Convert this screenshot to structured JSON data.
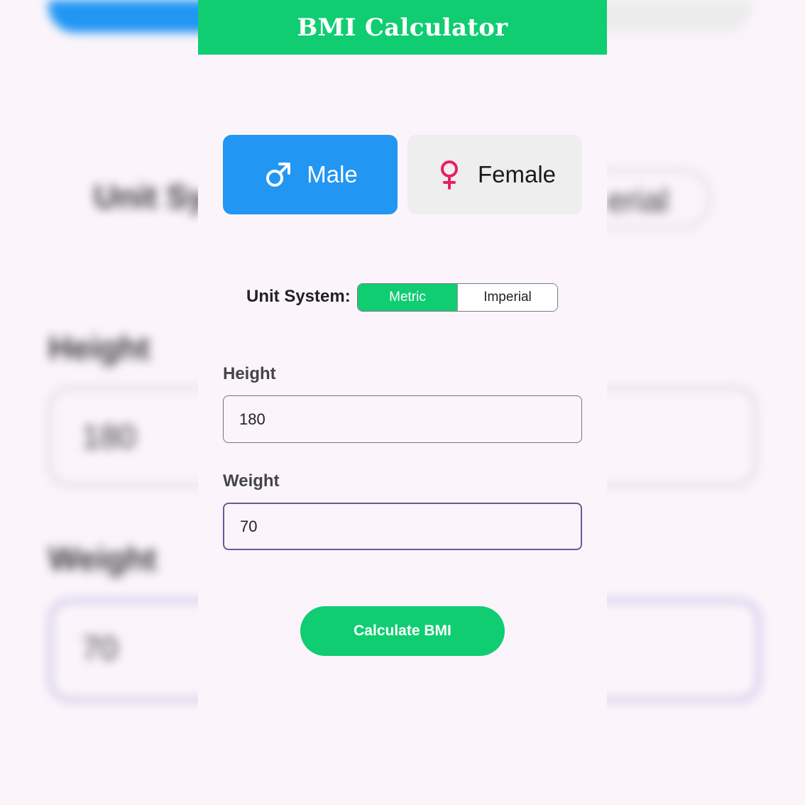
{
  "app_bar": {
    "title": "BMI Calculator"
  },
  "gender": {
    "male": {
      "label": "Male",
      "icon": "male-symbol-icon",
      "selected": true
    },
    "female": {
      "label": "Female",
      "icon": "female-symbol-icon",
      "selected": false
    }
  },
  "unit_system": {
    "label": "Unit System:",
    "options": [
      "Metric",
      "Imperial"
    ],
    "selected": "Metric"
  },
  "height": {
    "label": "Height",
    "value": "180"
  },
  "weight": {
    "label": "Weight",
    "value": "70"
  },
  "actions": {
    "calculate_label": "Calculate BMI"
  },
  "background": {
    "unit_text": "Unit Sy",
    "unit_option_text": "erial",
    "height_label": "Height",
    "height_value": "180",
    "weight_label": "Weight",
    "weight_value": "70"
  },
  "colors": {
    "primary_green": "#10cd72",
    "male_blue": "#2196f3",
    "female_pink": "#e91e63",
    "focused_border": "#6a5a96"
  }
}
